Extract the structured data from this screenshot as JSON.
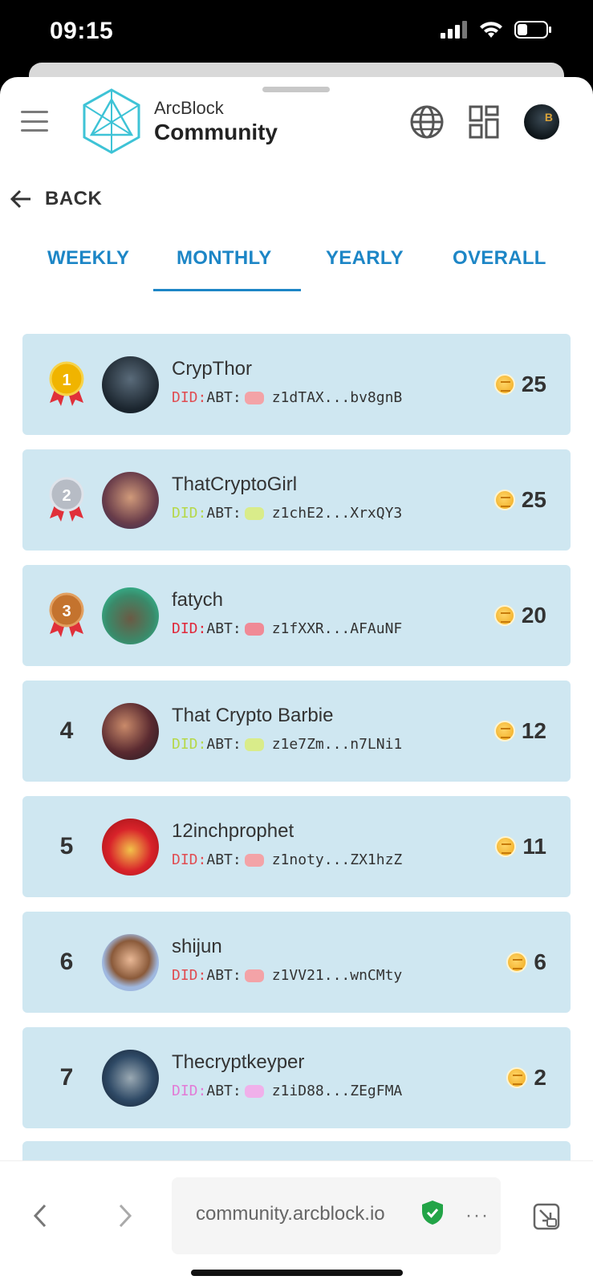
{
  "status_bar": {
    "time": "09:15"
  },
  "header": {
    "brand_top": "ArcBlock",
    "brand_bottom": "Community"
  },
  "back": {
    "label": "BACK"
  },
  "tabs": [
    {
      "label": "WEEKLY"
    },
    {
      "label": "MONTHLY"
    },
    {
      "label": "YEARLY"
    },
    {
      "label": "OVERALL"
    }
  ],
  "active_tab": "MONTHLY",
  "leaders": [
    {
      "rank": "1",
      "name": "CrypThor",
      "did_prefix": "DID:",
      "did_scheme": "ABT:",
      "did_addr": "z1dTAX...bv8gnB",
      "score": "25",
      "prefix_color": "#e04d52",
      "dot_color": "#f3a3a7"
    },
    {
      "rank": "2",
      "name": "ThatCryptoGirl",
      "did_prefix": "DID:",
      "did_scheme": "ABT:",
      "did_addr": "z1chE2...XrxQY3",
      "score": "25",
      "prefix_color": "#b6d84a",
      "dot_color": "#d9ec8a"
    },
    {
      "rank": "3",
      "name": "fatych",
      "did_prefix": "DID:",
      "did_scheme": "ABT:",
      "did_addr": "z1fXXR...AFAuNF",
      "score": "20",
      "prefix_color": "#e0283a",
      "dot_color": "#f08a96"
    },
    {
      "rank": "4",
      "name": "That Crypto Barbie",
      "did_prefix": "DID:",
      "did_scheme": "ABT:",
      "did_addr": "z1e7Zm...n7LNi1",
      "score": "12",
      "prefix_color": "#b6d84a",
      "dot_color": "#d9ec8a"
    },
    {
      "rank": "5",
      "name": "12inchprophet",
      "did_prefix": "DID:",
      "did_scheme": "ABT:",
      "did_addr": "z1noty...ZX1hzZ",
      "score": "11",
      "prefix_color": "#e04d52",
      "dot_color": "#f3a3a7"
    },
    {
      "rank": "6",
      "name": "shijun",
      "did_prefix": "DID:",
      "did_scheme": "ABT:",
      "did_addr": "z1VV21...wnCMty",
      "score": "6",
      "prefix_color": "#e04d52",
      "dot_color": "#f3a3a7"
    },
    {
      "rank": "7",
      "name": "Thecryptkeyper",
      "did_prefix": "DID:",
      "did_scheme": "ABT:",
      "did_addr": "z1iD88...ZEgFMA",
      "score": "2",
      "prefix_color": "#e27bd6",
      "dot_color": "#f0b0ea"
    }
  ],
  "browser": {
    "url": "community.arcblock.io",
    "more": "···"
  },
  "colors": {
    "accent": "#1d86c6",
    "row_bg": "#cfe7f1",
    "gold": "#f0b400",
    "silver": "#b7bcc5",
    "bronze": "#c4732e"
  },
  "icons": [
    "menu-icon",
    "arcblock-logo",
    "globe-icon",
    "apps-grid-icon",
    "back-arrow-icon",
    "medal-icon",
    "coin-icon",
    "shield-check-icon",
    "chevron-left-icon",
    "chevron-right-icon",
    "open-external-icon"
  ]
}
